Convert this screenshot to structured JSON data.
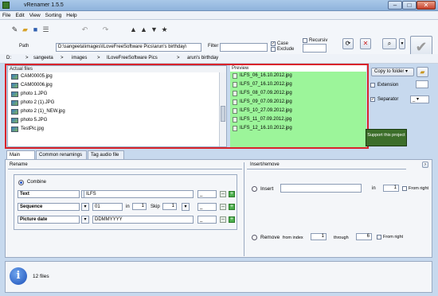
{
  "window": {
    "title": "vRenamer 1.5.5"
  },
  "menu": [
    "File",
    "Edit",
    "View",
    "Sorting",
    "Help"
  ],
  "path_row": {
    "path_label": "Path",
    "path_value": "D:\\sangeeta\\images\\ILoveFreeSoftware Pics\\arun's birthday\\",
    "filter_label": "Filter",
    "case_label": "Case",
    "exclude_label": "Exclude",
    "recursiv_label": "Recursiv"
  },
  "breadcrumb": [
    "D:",
    "sangeeta",
    "images",
    "ILoveFreeSoftware Pics",
    "arun's birthday"
  ],
  "actual_files": {
    "header": "Actual files",
    "items": [
      "CAM00005.jpg",
      "CAM00006.jpg",
      "photo 1.JPG",
      "photo 2 (1).JPG",
      "photo 2 (1)_NEW.jpg",
      "photo 5.JPG",
      "TestPic.jpg"
    ]
  },
  "preview": {
    "header": "Preview",
    "items": [
      "ILFS_06_16.10.2012.jpg",
      "ILFS_07_16.10.2012.jpg",
      "ILFS_08_07.09.2012.jpg",
      "ILFS_09_07.09.2012.jpg",
      "ILFS_10_27.09.2012.jpg",
      "ILFS_11_07.09.2012.jpg",
      "ILFS_12_16.10.2012.jpg"
    ]
  },
  "side": {
    "copy_to_folder": "Copy to folder",
    "extension": "Extension",
    "separator": "Separator",
    "separator_value": "_",
    "support_text": "Support this project"
  },
  "tabs": [
    "Main tasks",
    "Common renamings",
    "Tag audio file"
  ],
  "rename": {
    "header": "Rename",
    "combine_label": "Combine",
    "rows": [
      {
        "type": "Text",
        "value": "ILFS",
        "sep": "_"
      },
      {
        "type": "Sequence",
        "value": "01",
        "in_label": "in",
        "in_value": "1",
        "skip_label": "Skip",
        "skip_value": "1",
        "sep": "_"
      },
      {
        "type": "Picture date",
        "value": "DDMMYYYY",
        "sep": "_"
      }
    ]
  },
  "insert_remove": {
    "header": "Insert/remove",
    "insert_label": "Insert",
    "in_label": "in",
    "insert_in_value": "1",
    "from_right_label": "From right",
    "remove_label": "Remove",
    "from_index_label": "from index",
    "from_index_value": "1",
    "through_label": "through",
    "through_value": "6"
  },
  "status": {
    "text": "12 files"
  },
  "colors": {
    "accent_frame": "#d9242b",
    "preview_bg": "#9cf59a"
  }
}
